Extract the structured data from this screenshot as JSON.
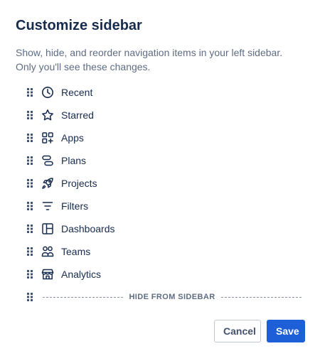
{
  "dialog": {
    "title": "Customize sidebar",
    "description": "Show, hide, and reorder navigation items in your left sidebar. Only you'll see these changes."
  },
  "items": [
    {
      "label": "Recent",
      "icon": "clock-icon"
    },
    {
      "label": "Starred",
      "icon": "star-icon"
    },
    {
      "label": "Apps",
      "icon": "apps-icon"
    },
    {
      "label": "Plans",
      "icon": "plans-icon"
    },
    {
      "label": "Projects",
      "icon": "rocket-icon"
    },
    {
      "label": "Filters",
      "icon": "filter-icon"
    },
    {
      "label": "Dashboards",
      "icon": "dashboard-icon"
    },
    {
      "label": "Teams",
      "icon": "people-icon"
    },
    {
      "label": "Analytics",
      "icon": "store-icon"
    }
  ],
  "divider": {
    "label": "HIDE FROM SIDEBAR"
  },
  "buttons": {
    "cancel": "Cancel",
    "save": "Save"
  },
  "colors": {
    "primary": "#1d5fd6",
    "text": "#172b4d",
    "subtle": "#5e6c84"
  }
}
